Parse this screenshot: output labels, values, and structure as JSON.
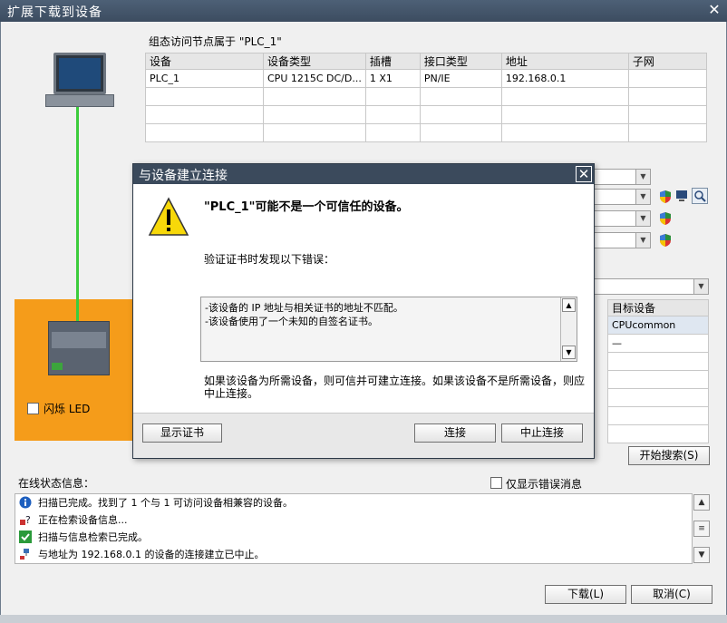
{
  "window": {
    "title": "扩展下载到设备",
    "close": "✕"
  },
  "config": {
    "group_label": "组态访问节点属于 \"PLC_1\"",
    "columns": [
      "设备",
      "设备类型",
      "插槽",
      "接口类型",
      "地址",
      "子网"
    ],
    "rows": [
      [
        "PLC_1",
        "CPU 1215C DC/D...",
        "1 X1",
        "PN/IE",
        "192.168.0.1",
        ""
      ],
      [
        "",
        "",
        "",
        "",
        "",
        ""
      ],
      [
        "",
        "",
        "",
        "",
        "",
        ""
      ],
      [
        "",
        "",
        "",
        "",
        "",
        ""
      ]
    ]
  },
  "panel": {
    "flash_led_label": "闪烁 LED"
  },
  "target": {
    "header": "目标设备",
    "rows": [
      "CPUcommon",
      "—",
      "",
      "",
      "",
      "",
      ""
    ]
  },
  "start_search_label": "开始搜索(S)",
  "status": {
    "title": "在线状态信息：",
    "only_errors_label": "仅显示错误消息",
    "messages": [
      {
        "icon": "info-icon",
        "text": "扫描已完成。找到了 1 个与 1 可访问设备相兼容的设备。"
      },
      {
        "icon": "query-icon",
        "text": "正在检索设备信息..."
      },
      {
        "icon": "check-icon",
        "text": "扫描与信息检索已完成。"
      },
      {
        "icon": "network-error-icon",
        "text": "与地址为 192.168.0.1 的设备的连接建立已中止。"
      }
    ]
  },
  "dialog": {
    "title": "与设备建立连接",
    "close": "✕",
    "heading": "\"PLC_1\"可能不是一个可信任的设备。",
    "verify_line": "验证证书时发现以下错误：",
    "errors": [
      "-该设备的 IP 地址与相关证书的地址不匹配。",
      "-该设备使用了一个未知的自签名证书。"
    ],
    "note": "如果该设备为所需设备，则可信并可建立连接。如果该设备不是所需设备，则应中止连接。",
    "show_cert_label": "显示证书",
    "connect_label": "连接",
    "abort_label": "中止连接"
  },
  "footer": {
    "download_label": "下载(L)",
    "cancel_label": "取消(C)"
  },
  "colors": {
    "titlebar": "#3b4a5c",
    "orange": "#f59c1a",
    "link": "#3ccc3c"
  }
}
